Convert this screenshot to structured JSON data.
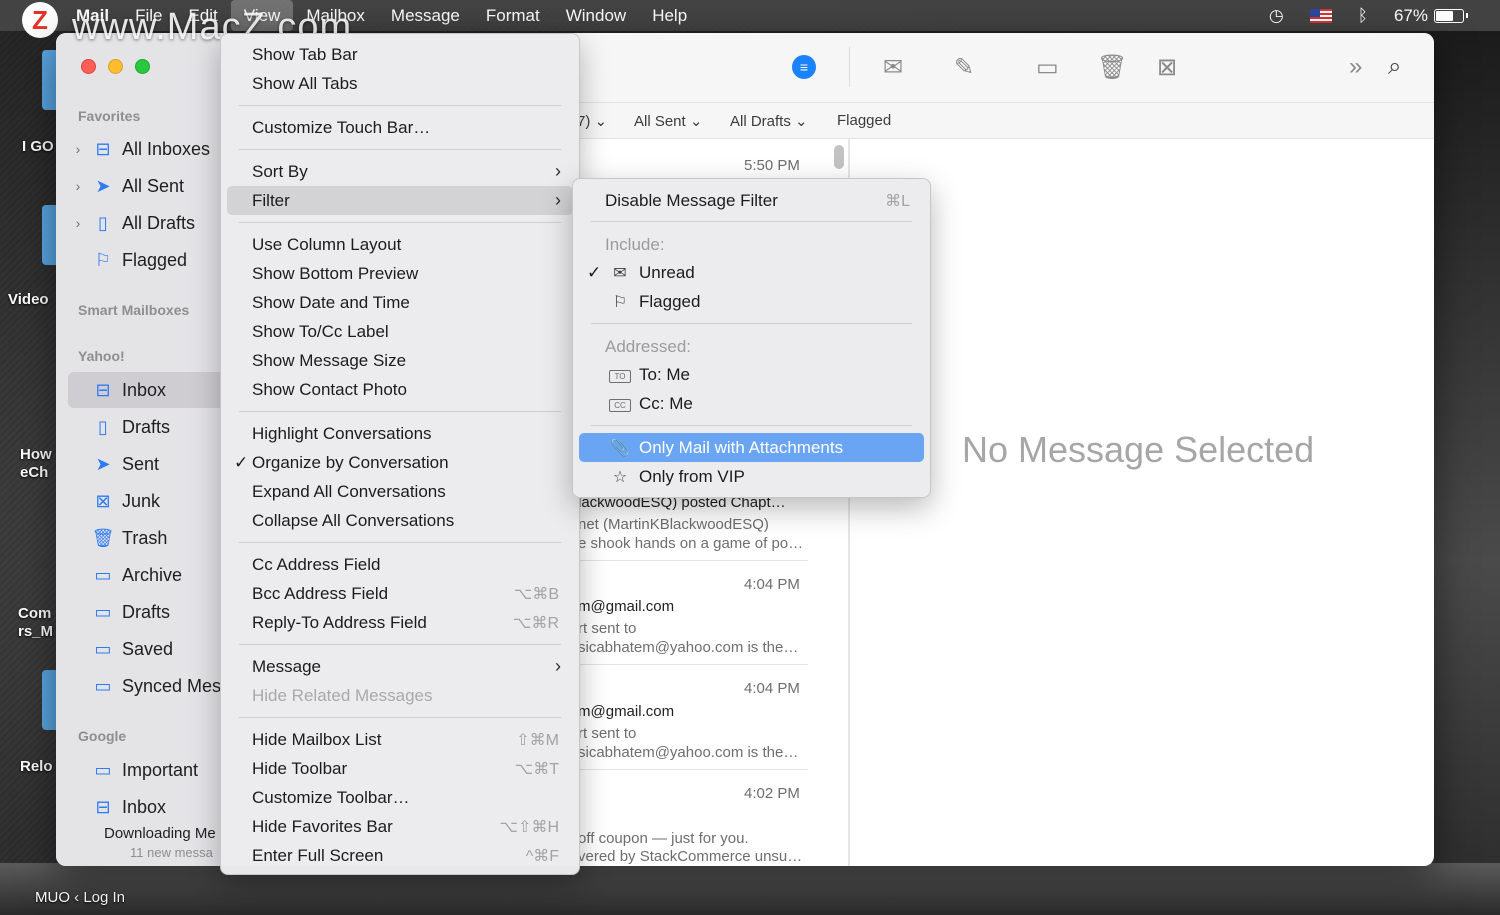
{
  "menubar": {
    "items": [
      {
        "label": "Mail",
        "app": true
      },
      {
        "label": "File"
      },
      {
        "label": "Edit"
      },
      {
        "label": "View",
        "active": true
      },
      {
        "label": "Mailbox"
      },
      {
        "label": "Message"
      },
      {
        "label": "Format"
      },
      {
        "label": "Window"
      },
      {
        "label": "Help"
      }
    ],
    "battery": "67%"
  },
  "watermark": "www.MacZ.com",
  "desktop": {
    "labels": [
      "I GO",
      "Video",
      "How eCh",
      "Com rs_M",
      "Relo",
      "MUO ‹ Log In"
    ]
  },
  "sidebar": {
    "favorites_label": "Favorites",
    "favorites": [
      {
        "label": "All Inboxes",
        "icon": "tray-icon"
      },
      {
        "label": "All Sent",
        "icon": "paperplane-icon"
      },
      {
        "label": "All Drafts",
        "icon": "document-icon"
      },
      {
        "label": "Flagged",
        "icon": "flag-icon"
      }
    ],
    "smart_label": "Smart Mailboxes",
    "yahoo_label": "Yahoo!",
    "yahoo": [
      {
        "label": "Inbox",
        "icon": "tray-icon",
        "selected": true
      },
      {
        "label": "Drafts",
        "icon": "document-icon"
      },
      {
        "label": "Sent",
        "icon": "paperplane-icon"
      },
      {
        "label": "Junk",
        "icon": "junk-icon"
      },
      {
        "label": "Trash",
        "icon": "trash-icon"
      },
      {
        "label": "Archive",
        "icon": "archive-icon"
      },
      {
        "label": "Drafts",
        "icon": "folder-icon"
      },
      {
        "label": "Saved",
        "icon": "folder-icon"
      },
      {
        "label": "Synced Mes",
        "icon": "folder-icon"
      }
    ],
    "google_label": "Google",
    "google": [
      {
        "label": "Important",
        "icon": "folder-icon"
      },
      {
        "label": "Inbox",
        "icon": "tray-icon"
      }
    ],
    "status": "Downloading Me",
    "status_sub": "11 new messa"
  },
  "favbar": {
    "items": [
      "7)",
      "All Sent",
      "All Drafts",
      "Flagged"
    ]
  },
  "messages": [
    {
      "time": "5:50 PM"
    },
    {
      "lines": [
        "lackwoodESQ) posted Chapt…",
        "net (MartinKBlackwoodESQ)",
        "e shook hands on a game of po…"
      ]
    },
    {
      "time": "4:04 PM",
      "lines": [
        "m@gmail.com",
        "rt sent to",
        "sicabhatem@yahoo.com is the…"
      ]
    },
    {
      "time": "4:04 PM",
      "lines": [
        "m@gmail.com",
        "rt sent to",
        "sicabhatem@yahoo.com is the…"
      ]
    },
    {
      "time": "4:02 PM",
      "lines": [
        "off coupon — just for you.",
        "vered by StackCommerce unsu…"
      ]
    }
  ],
  "no_message": "No Message Selected",
  "view_menu": {
    "items": [
      {
        "label": "Show Tab Bar"
      },
      {
        "label": "Show All Tabs"
      },
      {
        "sep": true
      },
      {
        "label": "Customize Touch Bar…"
      },
      {
        "sep": true
      },
      {
        "label": "Sort By",
        "submenu": true
      },
      {
        "label": "Filter",
        "submenu": true,
        "highlight": true
      },
      {
        "sep": true
      },
      {
        "label": "Use Column Layout"
      },
      {
        "label": "Show Bottom Preview"
      },
      {
        "label": "Show Date and Time"
      },
      {
        "label": "Show To/Cc Label"
      },
      {
        "label": "Show Message Size"
      },
      {
        "label": "Show Contact Photo"
      },
      {
        "sep": true
      },
      {
        "label": "Highlight Conversations"
      },
      {
        "label": "Organize by Conversation",
        "checked": true
      },
      {
        "label": "Expand All Conversations"
      },
      {
        "label": "Collapse All Conversations"
      },
      {
        "sep": true
      },
      {
        "label": "Cc Address Field"
      },
      {
        "label": "Bcc Address Field",
        "shortcut": "⌥⌘B"
      },
      {
        "label": "Reply-To Address Field",
        "shortcut": "⌥⌘R"
      },
      {
        "sep": true
      },
      {
        "label": "Message",
        "submenu": true
      },
      {
        "label": "Hide Related Messages",
        "disabled": true
      },
      {
        "sep": true
      },
      {
        "label": "Hide Mailbox List",
        "shortcut": "⇧⌘M"
      },
      {
        "label": "Hide Toolbar",
        "shortcut": "⌥⌘T"
      },
      {
        "label": "Customize Toolbar…"
      },
      {
        "label": "Hide Favorites Bar",
        "shortcut": "⌥⇧⌘H"
      },
      {
        "label": "Enter Full Screen",
        "shortcut": "^⌘F"
      }
    ]
  },
  "filter_menu": {
    "disable_label": "Disable Message Filter",
    "disable_shortcut": "⌘L",
    "include_label": "Include:",
    "unread_label": "Unread",
    "flagged_label": "Flagged",
    "addressed_label": "Addressed:",
    "to_label": "To: Me",
    "to_tag": "TO",
    "cc_label": "Cc: Me",
    "cc_tag": "CC",
    "attach_label": "Only Mail with Attachments",
    "vip_label": "Only from VIP"
  }
}
